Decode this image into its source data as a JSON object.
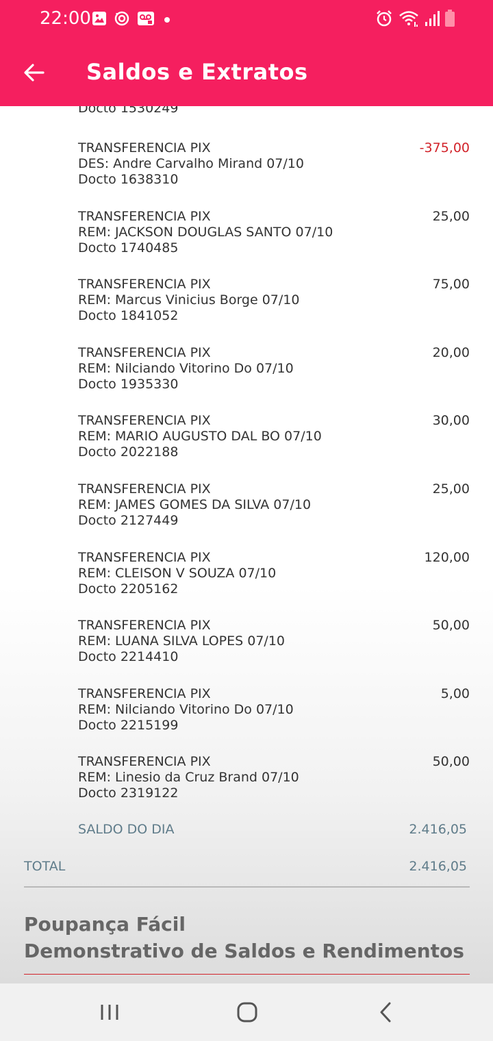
{
  "status_bar": {
    "time": "22:00",
    "left_icons": [
      "image-icon",
      "sync-icon",
      "voicemail-icon",
      "dot-icon"
    ],
    "right_icons": [
      "alarm-icon",
      "wifi-icon",
      "signal-icon",
      "battery-icon"
    ],
    "battery_color": "#ff8fa8"
  },
  "app_bar": {
    "title": "Saldos e Extratos",
    "background": "#f51f5f"
  },
  "statement": {
    "cut_off_doc": "Docto 1530249",
    "transactions": [
      {
        "type": "TRANSFERENCIA PIX",
        "detail": "DES: Andre Carvalho Mirand 07/10",
        "doc": "Docto 1638310",
        "amount": "-375,00"
      },
      {
        "type": "TRANSFERENCIA PIX",
        "detail": "REM: JACKSON DOUGLAS SANTO 07/10",
        "doc": "Docto 1740485",
        "amount": "25,00"
      },
      {
        "type": "TRANSFERENCIA PIX",
        "detail": "REM: Marcus Vinicius Borge 07/10",
        "doc": "Docto 1841052",
        "amount": "75,00"
      },
      {
        "type": "TRANSFERENCIA PIX",
        "detail": "REM: Nilciando Vitorino Do 07/10",
        "doc": "Docto 1935330",
        "amount": "20,00"
      },
      {
        "type": "TRANSFERENCIA PIX",
        "detail": "REM: MARIO AUGUSTO DAL BO 07/10",
        "doc": "Docto 2022188",
        "amount": "30,00"
      },
      {
        "type": "TRANSFERENCIA PIX",
        "detail": "REM: JAMES GOMES DA SILVA 07/10",
        "doc": "Docto 2127449",
        "amount": "25,00"
      },
      {
        "type": "TRANSFERENCIA PIX",
        "detail": "REM: CLEISON V SOUZA 07/10",
        "doc": "Docto 2205162",
        "amount": "120,00"
      },
      {
        "type": "TRANSFERENCIA PIX",
        "detail": "REM: LUANA SILVA LOPES 07/10",
        "doc": "Docto 2214410",
        "amount": "50,00"
      },
      {
        "type": "TRANSFERENCIA PIX",
        "detail": "REM: Nilciando Vitorino Do 07/10",
        "doc": "Docto 2215199",
        "amount": "5,00"
      },
      {
        "type": "TRANSFERENCIA PIX",
        "detail": "REM: Linesio da Cruz Brand 07/10",
        "doc": "Docto 2319122",
        "amount": "50,00"
      }
    ],
    "saldo_do_dia": {
      "label": "SALDO DO DIA",
      "value": "2.416,05"
    },
    "total": {
      "label": "TOTAL",
      "value": "2.416,05"
    },
    "negative_color": "#d2232a"
  },
  "poupanca": {
    "title_line1": "Poupança Fácil",
    "title_line2": "Demonstrativo de Saldos e Rendimentos"
  },
  "nav_bar": {
    "buttons": [
      "recents-icon",
      "home-icon",
      "back-nav-icon"
    ]
  }
}
